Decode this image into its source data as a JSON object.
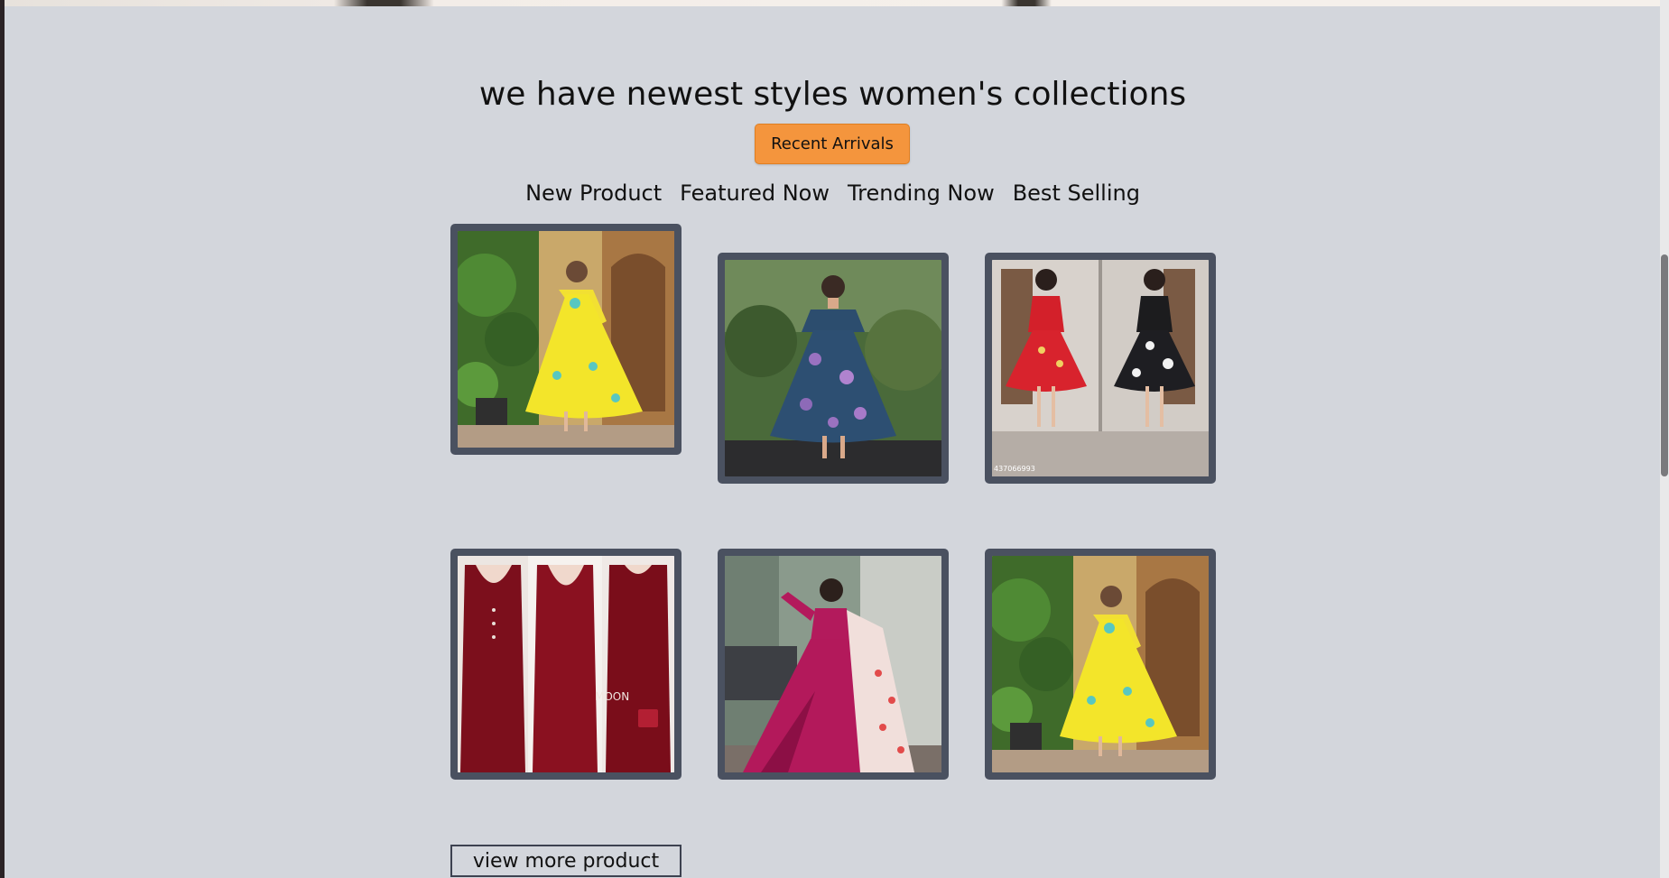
{
  "section": {
    "heading": "we have newest styles women's collections",
    "recent_button_label": "Recent Arrivals",
    "tabs": [
      {
        "label": "New Product"
      },
      {
        "label": "Featured Now"
      },
      {
        "label": "Trending Now"
      },
      {
        "label": "Best Selling"
      }
    ],
    "products": [
      {
        "image": "yellow-dress-photo"
      },
      {
        "image": "blue-floral-dress-photo"
      },
      {
        "image": "red-and-black-dresses-photo",
        "watermark": "437066993"
      },
      {
        "image": "maroon-velvet-dresses-photo",
        "overlay_text": "MOON"
      },
      {
        "image": "magenta-gown-photo"
      },
      {
        "image": "yellow-dress-photo"
      }
    ],
    "view_more_label": "view more product"
  },
  "colors": {
    "background": "#d3d6dc",
    "accent": "#f4953d",
    "card_frame": "#4a5160"
  }
}
